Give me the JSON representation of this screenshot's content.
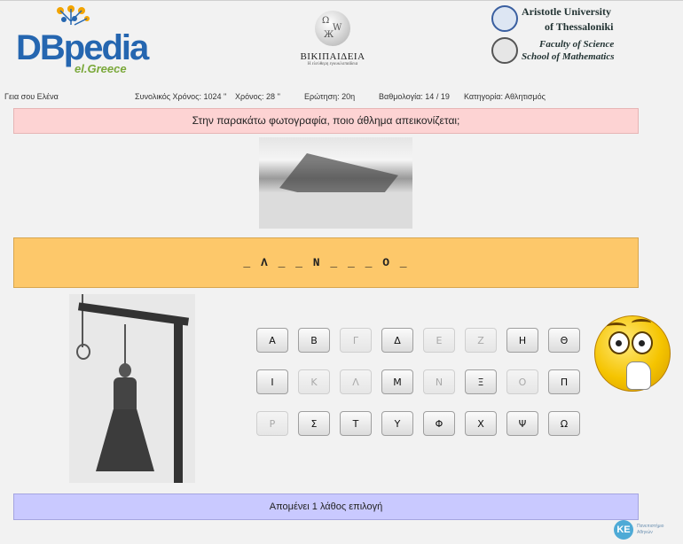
{
  "header": {
    "dbpedia_word": "DBpedia",
    "dbpedia_sub": "el.Greece",
    "wiki_name": "ΒΙΚΙΠΑΙΔΕΙΑ",
    "wiki_tagline": "Η ελεύθερη εγκυκλοπαίδεια",
    "university": {
      "line1": "Aristotle University",
      "line2": "of Thessaloniki",
      "line3": "Faculty of Science",
      "line4": "School of Mathematics"
    }
  },
  "status": {
    "greeting": "Γεια σου Ελένα",
    "total_time": "Συνολικός Χρόνος: 1024 ''",
    "time": "Χρόνος: 28 ''",
    "question_no": "Ερώτηση: 20η",
    "score": "Βαθμολογία: 14 / 19",
    "category": "Κατηγορία: Αθλητισμός"
  },
  "question": "Στην παρακάτω φωτογραφία, ποιο άθλημα απεικονίζεται;",
  "answer_pattern": "_ Λ _ _ Ν _ _ _ Ο _",
  "keyboard": {
    "rows": [
      [
        {
          "label": "Α",
          "enabled": true
        },
        {
          "label": "Β",
          "enabled": true
        },
        {
          "label": "Γ",
          "enabled": false
        },
        {
          "label": "Δ",
          "enabled": true
        },
        {
          "label": "Ε",
          "enabled": false
        },
        {
          "label": "Ζ",
          "enabled": false
        },
        {
          "label": "Η",
          "enabled": true
        },
        {
          "label": "Θ",
          "enabled": true
        }
      ],
      [
        {
          "label": "Ι",
          "enabled": true
        },
        {
          "label": "Κ",
          "enabled": false
        },
        {
          "label": "Λ",
          "enabled": false
        },
        {
          "label": "Μ",
          "enabled": true
        },
        {
          "label": "Ν",
          "enabled": false
        },
        {
          "label": "Ξ",
          "enabled": true
        },
        {
          "label": "Ο",
          "enabled": false
        },
        {
          "label": "Π",
          "enabled": true
        }
      ],
      [
        {
          "label": "Ρ",
          "enabled": false
        },
        {
          "label": "Σ",
          "enabled": true
        },
        {
          "label": "Τ",
          "enabled": true
        },
        {
          "label": "Υ",
          "enabled": true
        },
        {
          "label": "Φ",
          "enabled": true
        },
        {
          "label": "Χ",
          "enabled": true
        },
        {
          "label": "Ψ",
          "enabled": true
        },
        {
          "label": "Ω",
          "enabled": true
        }
      ]
    ]
  },
  "remaining": "Απομένει 1 λάθος επιλογή",
  "footer_logo": {
    "text": "Πανεπιστήμιο Αθηνών"
  },
  "icons": {
    "question_photo": "mountain-photo-icon",
    "hangman": "hangman-gallows-icon",
    "emoji": "thinking-emoji-icon"
  }
}
